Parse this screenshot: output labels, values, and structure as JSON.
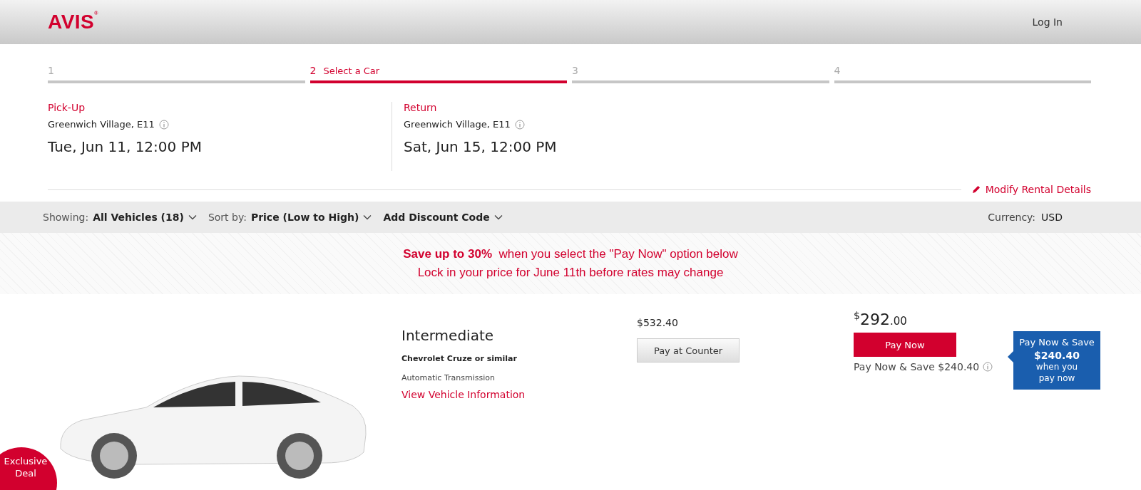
{
  "header": {
    "logo": "AVIS",
    "logo_mark": "®",
    "login": "Log In"
  },
  "steps": [
    {
      "number": "1",
      "selected": false
    },
    {
      "number": "2",
      "label": "Select a Car",
      "selected": true
    },
    {
      "number": "3",
      "selected": false
    },
    {
      "number": "4",
      "selected": false
    }
  ],
  "pickup": {
    "heading": "Pick-Up",
    "location": "Greenwich Village, E11",
    "datetime": "Tue, Jun 11, 12:00 PM"
  },
  "return": {
    "heading": "Return",
    "location": "Greenwich Village, E11",
    "datetime": "Sat, Jun 15, 12:00 PM"
  },
  "modify_link": "Modify Rental Details",
  "filters": [
    {
      "label": "Showing:",
      "value": "All Vehicles (18)"
    },
    {
      "label": "Sort by:",
      "value": "Price (Low to High)"
    },
    {
      "value": "Add Discount Code"
    }
  ],
  "currency": {
    "label": "Currency:",
    "value": "USD"
  },
  "promo": {
    "line1": "**Save up to 30%**  when you select the \"Pay Now\" option below",
    "line2": "Lock in your price for June 11th before rates may change"
  },
  "vehicle": {
    "class": "Intermediate",
    "model": "Chevrolet Cruze or similar",
    "transmission": "Automatic Transmission",
    "info_link": "View Vehicle Information",
    "counter_price": "$532.40",
    "counter_button": "Pay at Counter",
    "pay_now_price": {
      "symbol": "$",
      "whole": "292",
      "cents": ".00"
    },
    "pay_now_button": "Pay Now",
    "savings_note": "Pay Now & Save $240.40",
    "tag": {
      "line1": "Pay Now & Save",
      "line2": "$240.40",
      "line3": "when you",
      "line4": "pay now"
    },
    "badge": {
      "line1": "Exclusive",
      "line2": "Deal"
    }
  }
}
